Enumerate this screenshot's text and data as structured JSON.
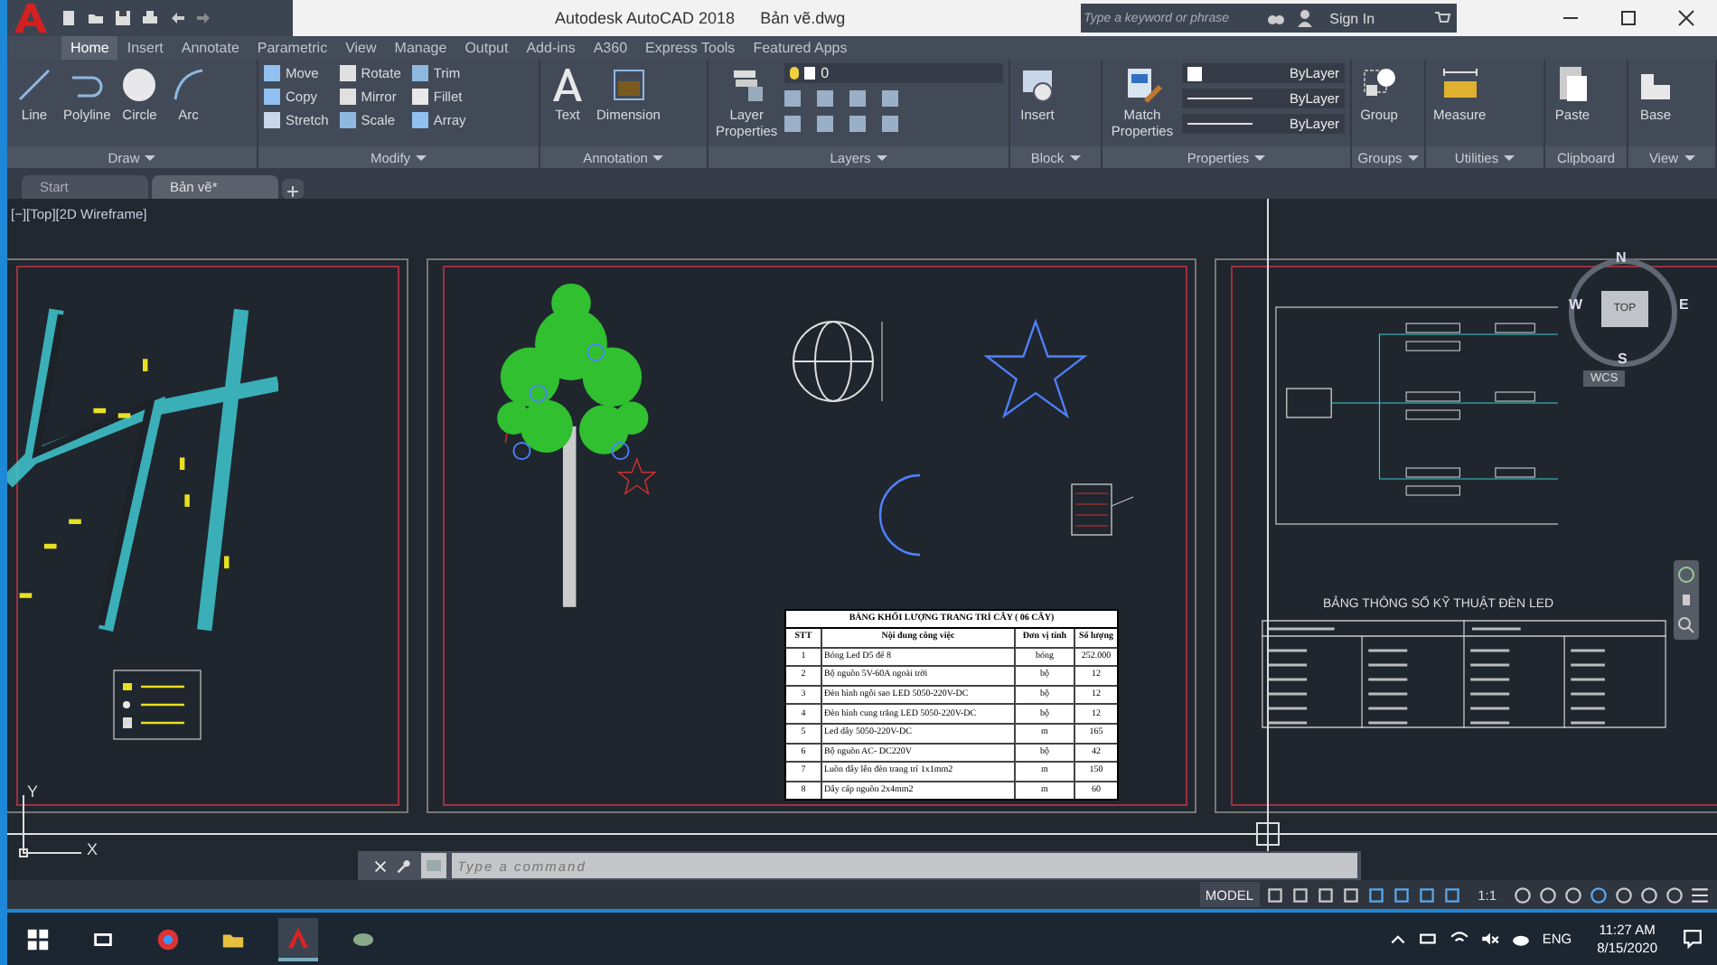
{
  "title_bar": {
    "app_title": "Autodesk AutoCAD 2018",
    "file_name": "Bản vẽ.dwg",
    "search": {
      "placeholder": "Type a keyword or phrase"
    },
    "sign_in": "Sign In"
  },
  "ribbon_tabs": [
    {
      "label": "Home",
      "selected": true
    },
    {
      "label": "Insert",
      "selected": false
    },
    {
      "label": "Annotate",
      "selected": false
    },
    {
      "label": "Parametric",
      "selected": false
    },
    {
      "label": "View",
      "selected": false
    },
    {
      "label": "Manage",
      "selected": false
    },
    {
      "label": "Output",
      "selected": false
    },
    {
      "label": "Add-ins",
      "selected": false
    },
    {
      "label": "A360",
      "selected": false
    },
    {
      "label": "Express Tools",
      "selected": false
    },
    {
      "label": "Featured Apps",
      "selected": false
    }
  ],
  "ribbon_panels": [
    {
      "title": "Draw",
      "expandable": true,
      "large_tools": [
        "Line",
        "Polyline",
        "Circle",
        "Arc"
      ]
    },
    {
      "title": "Modify",
      "expandable": true,
      "small_tools": [
        "Move",
        "Rotate",
        "Trim",
        "Copy",
        "Mirror",
        "Fillet",
        "Stretch",
        "Scale",
        "Array"
      ]
    },
    {
      "title": "Annotation",
      "expandable": true,
      "large_tools": [
        "Text",
        "Dimension"
      ]
    },
    {
      "title": "Layers",
      "expandable": true,
      "large_tools": [
        "Layer Properties"
      ],
      "layer": "0"
    },
    {
      "title": "Block",
      "expandable": true,
      "large_tools": [
        "Insert"
      ]
    },
    {
      "title": "Properties",
      "expandable": true,
      "large_tools": [
        "Match Properties"
      ],
      "dropdowns": [
        "ByLayer",
        "ByLayer",
        "ByLayer"
      ]
    },
    {
      "title": "Groups",
      "expandable": true,
      "large_tools": [
        "Group"
      ]
    },
    {
      "title": "Utilities",
      "expandable": true,
      "large_tools": [
        "Measure"
      ]
    },
    {
      "title": "Clipboard",
      "expandable": false,
      "large_tools": [
        "Paste"
      ]
    },
    {
      "title": "View",
      "expandable": true,
      "large_tools": [
        "Base"
      ]
    }
  ],
  "document_tabs": [
    {
      "label": "Start",
      "selected": false
    },
    {
      "label": "Bản vẽ*",
      "selected": true
    }
  ],
  "viewport_label": "[−][Top][2D Wireframe]",
  "drawing": {
    "quantity_table": {
      "title": "BẢNG KHỐI LƯỢNG TRANG TRÍ CÂY ( 06 CÂY)",
      "columns": [
        "STT",
        "Nội dung công việc",
        "Đơn vị tính",
        "Số lượng"
      ],
      "rows": [
        [
          "1",
          "Bóng Led D5 đế 8",
          "bóng",
          "252.000"
        ],
        [
          "2",
          "Bộ nguồn 5V-60A ngoài trời",
          "bộ",
          "12"
        ],
        [
          "3",
          "Đèn hình ngôi sao LED 5050-220V-DC",
          "bộ",
          "12"
        ],
        [
          "4",
          "Đèn hình cung trăng LED 5050-220V-DC",
          "bộ",
          "12"
        ],
        [
          "5",
          "Led dây 5050-220V-DC",
          "m",
          "165"
        ],
        [
          "6",
          "Bộ nguồn AC- DC220V",
          "bộ",
          "42"
        ],
        [
          "7",
          "Luồn dây lên đèn trang trí 1x1mm2",
          "m",
          "150"
        ],
        [
          "8",
          "Dây cấp nguồn 2x4mm2",
          "m",
          "60"
        ]
      ]
    },
    "spec_table": {
      "title": "BẢNG THÔNG SỐ KỸ THUẬT ĐÈN LED"
    }
  },
  "view_cube": {
    "top": "TOP",
    "north": "N",
    "south": "S",
    "east": "E",
    "west": "W",
    "ucs": "WCS"
  },
  "ucs_icon": {
    "x": "X",
    "y": "Y"
  },
  "command_line": {
    "placeholder": "Type a command"
  },
  "status_bar": {
    "model": "MODEL",
    "scale": "1:1"
  },
  "taskbar": {
    "language": "ENG",
    "time": "11:27 AM",
    "date": "8/15/2020"
  }
}
